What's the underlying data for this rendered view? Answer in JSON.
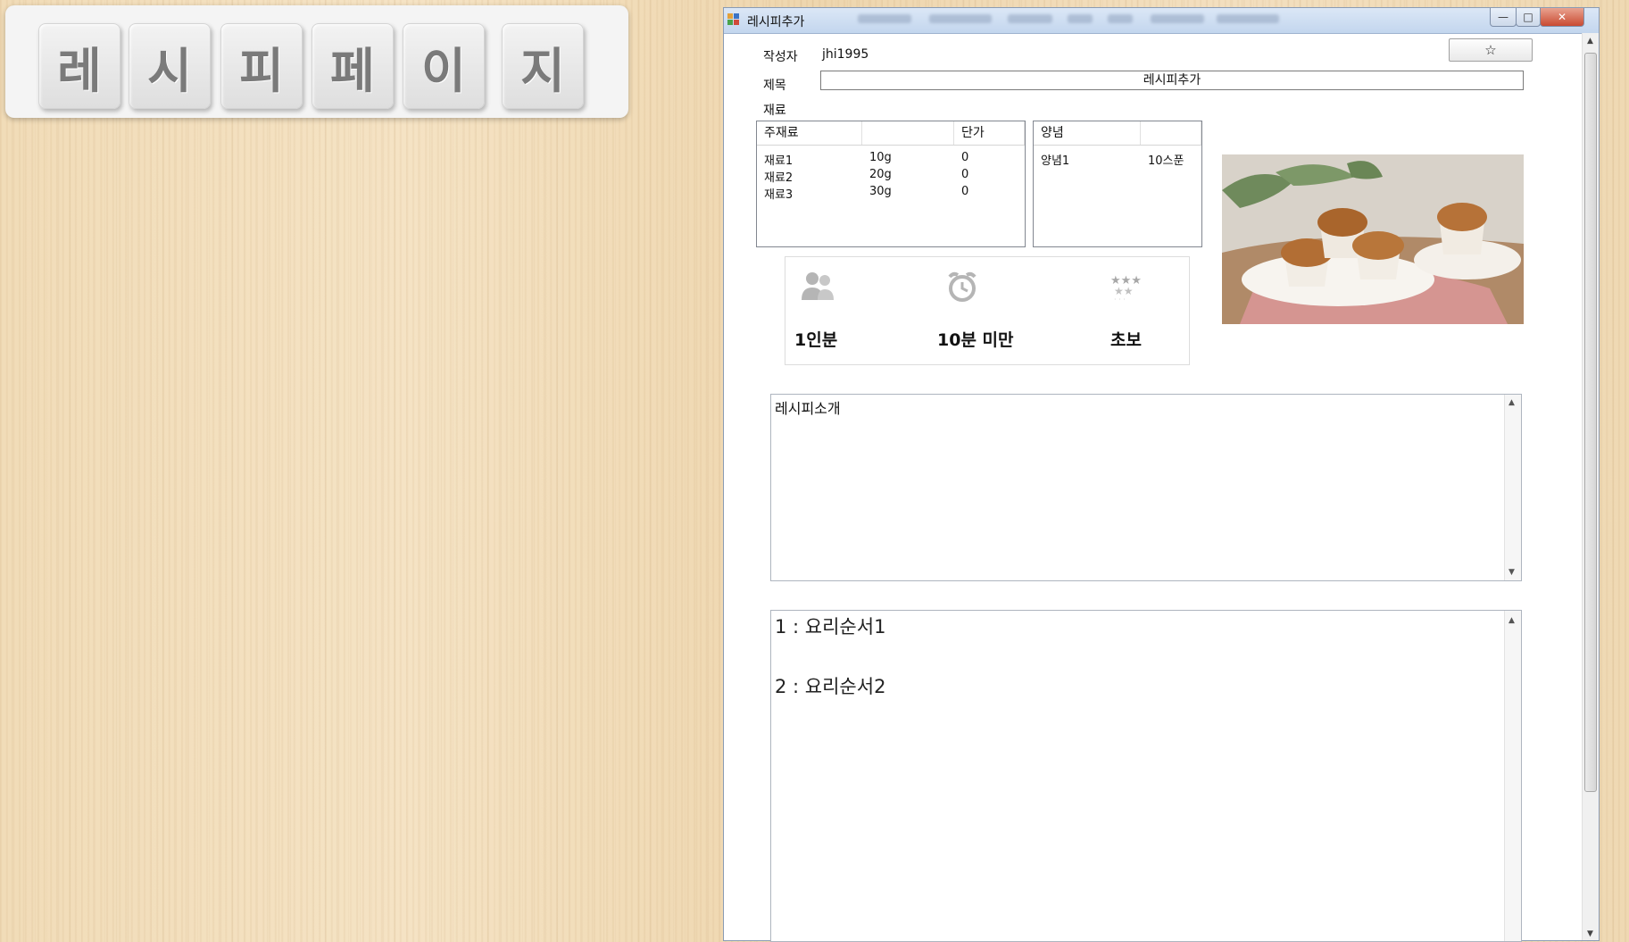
{
  "title_tiles": [
    "레",
    "시",
    "피",
    "페",
    "이",
    "지"
  ],
  "window": {
    "title": "레시피추가",
    "buttons": [
      "—",
      "□",
      "✕"
    ]
  },
  "form": {
    "author_label": "작성자",
    "author_value": "jhi1995",
    "favorite_button": "☆",
    "title_label": "제목",
    "title_value": "레시피추가",
    "ingredients_label": "재료"
  },
  "main_ingredients": {
    "columns": [
      "주재료",
      "",
      "단가"
    ],
    "rows": [
      [
        "재료1",
        "10g",
        "0"
      ],
      [
        "재료2",
        "20g",
        "0"
      ],
      [
        "재료3",
        "30g",
        "0"
      ]
    ]
  },
  "seasonings": {
    "columns": [
      "양념",
      ""
    ],
    "rows": [
      [
        "양념1",
        "10스푼"
      ]
    ]
  },
  "info": {
    "servings": "1인분",
    "time": "10분 미만",
    "difficulty": "초보"
  },
  "icons": {
    "servings": "people-icon",
    "time": "alarm-clock-icon",
    "difficulty": "stars-icon",
    "app": "app-window-icon"
  },
  "intro": "레시피소개",
  "steps": [
    "1 : 요리순서1",
    "2 : 요리순서2"
  ]
}
